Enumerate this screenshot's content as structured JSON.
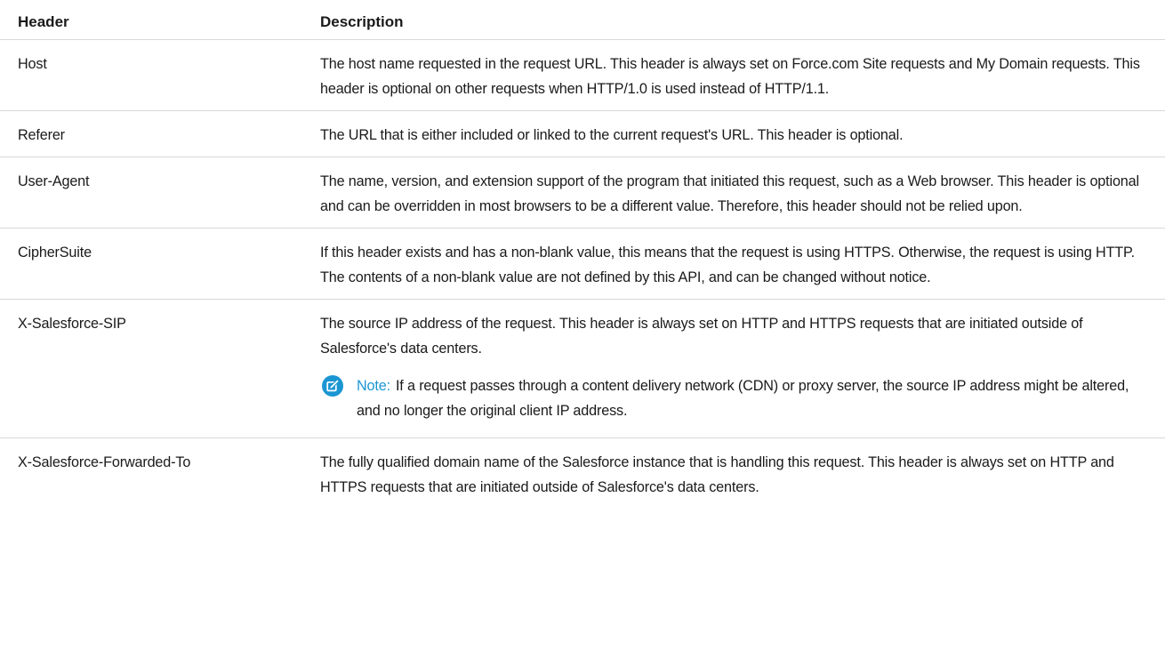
{
  "table": {
    "headers": {
      "header": "Header",
      "description": "Description"
    },
    "rows": [
      {
        "header": "Host",
        "description": "The host name requested in the request URL. This header is always set on Force.com Site requests and My Domain requests. This header is optional on other requests when HTTP/1.0 is used instead of HTTP/1.1."
      },
      {
        "header": "Referer",
        "description": "The URL that is either included or linked to the current request's URL. This header is optional."
      },
      {
        "header": "User-Agent",
        "description": "The name, version, and extension support of the program that initiated this request, such as a Web browser. This header is optional and can be overridden in most browsers to be a different value. Therefore, this header should not be relied upon."
      },
      {
        "header": "CipherSuite",
        "description": "If this header exists and has a non-blank value, this means that the request is using HTTPS. Otherwise, the request is using HTTP. The contents of a non-blank value are not defined by this API, and can be changed without notice."
      },
      {
        "header": "X-Salesforce-SIP",
        "description": "The source IP address of the request. This header is always set on HTTP and HTTPS requests that are initiated outside of Salesforce's data centers.",
        "note": {
          "label": "Note:",
          "text": "If a request passes through a content delivery network (CDN) or proxy server, the source IP address might be altered, and no longer the original client IP address.",
          "icon": "edit-note-icon",
          "color": "#1b96d3"
        }
      },
      {
        "header": "X-Salesforce-Forwarded-To",
        "description": "The fully qualified domain name of the Salesforce instance that is handling this request. This header is always set on HTTP and HTTPS requests that are initiated outside of Salesforce's data centers."
      }
    ]
  }
}
